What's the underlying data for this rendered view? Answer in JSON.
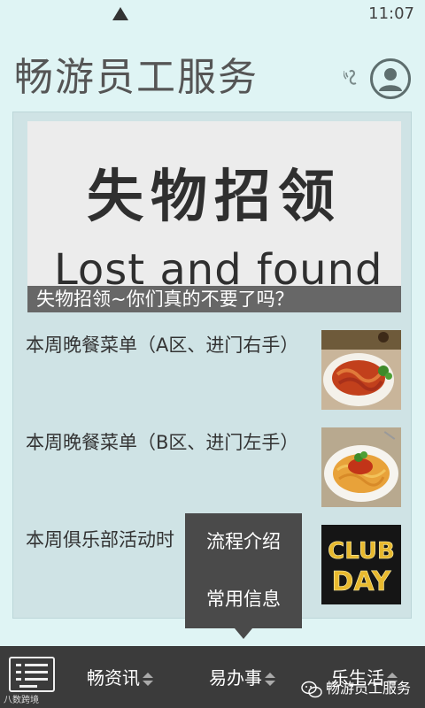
{
  "status_bar": {
    "time": "11:07"
  },
  "header": {
    "title": "畅游员工服务",
    "icons": [
      "ear-icon",
      "user-avatar-icon"
    ]
  },
  "banner": {
    "image_text_cn": "失物招领",
    "image_text_en": "Lost and found",
    "caption": "失物招领~你们真的不要了吗？"
  },
  "news": [
    {
      "title": "本周晚餐菜单（A区、进门右手）",
      "thumb": "pasta-dish-image"
    },
    {
      "title": "本周晚餐菜单（B区、进门左手）",
      "thumb": "spaghetti-image"
    },
    {
      "title": "本周俱乐部活动时",
      "thumb": "club-day-image",
      "thumb_text": [
        "CLUB",
        "DAY"
      ]
    }
  ],
  "popup_menu": {
    "items": [
      "流程介绍",
      "常用信息"
    ]
  },
  "bottom_nav": {
    "menu_icon": "keyboard-menu-icon",
    "items": [
      "畅资讯",
      "易办事",
      "乐生活"
    ]
  },
  "watermark": {
    "text": "畅游员工服务",
    "corner": "八数跨境"
  },
  "colors": {
    "background": "#dff4f4",
    "card": "#cfe3e5",
    "bottom_bar": "#3b3b3b",
    "popup": "#4a4a4a"
  }
}
